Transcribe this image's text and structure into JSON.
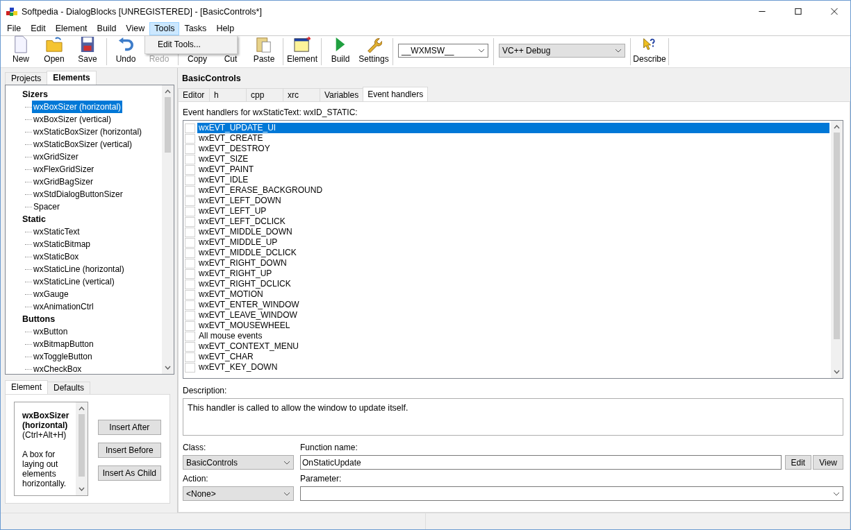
{
  "window": {
    "title": "Softpedia - DialogBlocks [UNREGISTERED] - [BasicControls*]"
  },
  "menu": [
    {
      "label": "File",
      "selected": false
    },
    {
      "label": "Edit",
      "selected": false
    },
    {
      "label": "Element",
      "selected": false
    },
    {
      "label": "Build",
      "selected": false
    },
    {
      "label": "View",
      "selected": false
    },
    {
      "label": "Tools",
      "selected": true
    },
    {
      "label": "Tasks",
      "selected": false
    },
    {
      "label": "Help",
      "selected": false
    }
  ],
  "open_menu": {
    "items": [
      "Edit Tools..."
    ]
  },
  "toolbar": {
    "groups": [
      [
        {
          "kind": "button",
          "label": "New",
          "disabled": false
        },
        {
          "kind": "button",
          "label": "Open",
          "disabled": false
        },
        {
          "kind": "button",
          "label": "Save",
          "disabled": false
        }
      ],
      [
        {
          "kind": "button",
          "label": "Undo",
          "disabled": false
        },
        {
          "kind": "button",
          "label": "Redo",
          "disabled": true
        }
      ],
      [
        {
          "kind": "button",
          "label": "Copy",
          "disabled": false
        },
        {
          "kind": "button",
          "label": "Cut",
          "disabled": false
        },
        {
          "kind": "button",
          "label": "Paste",
          "disabled": false
        }
      ],
      [
        {
          "kind": "button",
          "label": "Element",
          "disabled": false
        }
      ],
      [
        {
          "kind": "button",
          "label": "Build",
          "disabled": false
        },
        {
          "kind": "button",
          "label": "Settings",
          "disabled": false
        }
      ],
      [
        {
          "kind": "combo",
          "value": "__WXMSW__",
          "readonly": false
        }
      ],
      [
        {
          "kind": "combo",
          "value": "VC++ Debug",
          "readonly": true
        }
      ],
      [
        {
          "kind": "button",
          "label": "Describe",
          "disabled": false
        }
      ]
    ]
  },
  "left_panel": {
    "tabs": [
      {
        "label": "Projects",
        "selected": false
      },
      {
        "label": "Elements",
        "selected": true
      }
    ],
    "tree": [
      {
        "label": "Sizers",
        "children": [
          {
            "label": "wxBoxSizer (horizontal)",
            "selected": true
          },
          {
            "label": "wxBoxSizer (vertical)",
            "selected": false
          },
          {
            "label": "wxStaticBoxSizer (horizontal)",
            "selected": false
          },
          {
            "label": "wxStaticBoxSizer (vertical)",
            "selected": false
          },
          {
            "label": "wxGridSizer",
            "selected": false
          },
          {
            "label": "wxFlexGridSizer",
            "selected": false
          },
          {
            "label": "wxGridBagSizer",
            "selected": false
          },
          {
            "label": "wxStdDialogButtonSizer",
            "selected": false
          },
          {
            "label": "Spacer",
            "selected": false
          }
        ]
      },
      {
        "label": "Static",
        "children": [
          {
            "label": "wxStaticText",
            "selected": false
          },
          {
            "label": "wxStaticBitmap",
            "selected": false
          },
          {
            "label": "wxStaticBox",
            "selected": false
          },
          {
            "label": "wxStaticLine (horizontal)",
            "selected": false
          },
          {
            "label": "wxStaticLine (vertical)",
            "selected": false
          },
          {
            "label": "wxGauge",
            "selected": false
          },
          {
            "label": "wxAnimationCtrl",
            "selected": false
          }
        ]
      },
      {
        "label": "Buttons",
        "children": [
          {
            "label": "wxButton",
            "selected": false
          },
          {
            "label": "wxBitmapButton",
            "selected": false
          },
          {
            "label": "wxToggleButton",
            "selected": false
          },
          {
            "label": "wxCheckBox",
            "selected": false
          }
        ]
      }
    ],
    "bottom_tabs": [
      {
        "label": "Element",
        "selected": true
      },
      {
        "label": "Defaults",
        "selected": false
      }
    ],
    "info": {
      "name": "wxBoxSizer (horizontal)",
      "shortcut": "(Ctrl+Alt+H)",
      "description": "A box for laying out elements horizontally."
    },
    "buttons": [
      "Insert After",
      "Insert Before",
      "Insert As Child"
    ]
  },
  "editor": {
    "title": "BasicControls",
    "tabs": [
      {
        "label": "Editor",
        "selected": false
      },
      {
        "label": "h",
        "selected": false
      },
      {
        "label": "cpp",
        "selected": false
      },
      {
        "label": "xrc",
        "selected": false
      },
      {
        "label": "Variables",
        "selected": false
      },
      {
        "label": "Event handlers",
        "selected": true
      }
    ],
    "events_label": "Event handlers for wxStaticText: wxID_STATIC:",
    "events": [
      {
        "label": "wxEVT_UPDATE_UI",
        "checked": false,
        "selected": true
      },
      {
        "label": "wxEVT_CREATE",
        "checked": false,
        "selected": false
      },
      {
        "label": "wxEVT_DESTROY",
        "checked": false,
        "selected": false
      },
      {
        "label": "wxEVT_SIZE",
        "checked": false,
        "selected": false
      },
      {
        "label": "wxEVT_PAINT",
        "checked": false,
        "selected": false
      },
      {
        "label": "wxEVT_IDLE",
        "checked": false,
        "selected": false
      },
      {
        "label": "wxEVT_ERASE_BACKGROUND",
        "checked": false,
        "selected": false
      },
      {
        "label": "wxEVT_LEFT_DOWN",
        "checked": false,
        "selected": false
      },
      {
        "label": "wxEVT_LEFT_UP",
        "checked": false,
        "selected": false
      },
      {
        "label": "wxEVT_LEFT_DCLICK",
        "checked": false,
        "selected": false
      },
      {
        "label": "wxEVT_MIDDLE_DOWN",
        "checked": false,
        "selected": false
      },
      {
        "label": "wxEVT_MIDDLE_UP",
        "checked": false,
        "selected": false
      },
      {
        "label": "wxEVT_MIDDLE_DCLICK",
        "checked": false,
        "selected": false
      },
      {
        "label": "wxEVT_RIGHT_DOWN",
        "checked": false,
        "selected": false
      },
      {
        "label": "wxEVT_RIGHT_UP",
        "checked": false,
        "selected": false
      },
      {
        "label": "wxEVT_RIGHT_DCLICK",
        "checked": false,
        "selected": false
      },
      {
        "label": "wxEVT_MOTION",
        "checked": false,
        "selected": false
      },
      {
        "label": "wxEVT_ENTER_WINDOW",
        "checked": false,
        "selected": false
      },
      {
        "label": "wxEVT_LEAVE_WINDOW",
        "checked": false,
        "selected": false
      },
      {
        "label": "wxEVT_MOUSEWHEEL",
        "checked": false,
        "selected": false
      },
      {
        "label": "All mouse events",
        "checked": false,
        "selected": false
      },
      {
        "label": "wxEVT_CONTEXT_MENU",
        "checked": false,
        "selected": false
      },
      {
        "label": "wxEVT_CHAR",
        "checked": false,
        "selected": false
      },
      {
        "label": "wxEVT_KEY_DOWN",
        "checked": false,
        "selected": false
      }
    ],
    "description_label": "Description:",
    "description": "This handler is called to allow the window to update itself.",
    "class_label": "Class:",
    "class_value": "BasicControls",
    "function_label": "Function name:",
    "function_value": "OnStaticUpdate",
    "function_buttons": [
      "Edit",
      "View"
    ],
    "action_label": "Action:",
    "action_value": "<None>",
    "parameter_label": "Parameter:"
  }
}
